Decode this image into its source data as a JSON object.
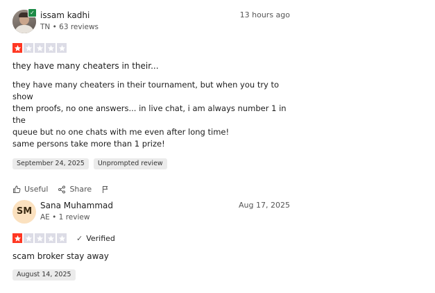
{
  "reviews": [
    {
      "reviewer_name": "issam kadhi",
      "meta": "TN • 63 reviews",
      "date": "13 hours ago",
      "rating": 1,
      "title": "they have many cheaters in their...",
      "body": "they have many cheaters in their tournament, but when you try to show\nthem proofs, no one answers... in live chat, i am always number 1 in the\nqueue but no one chats with me even after long time!\nsame persons take more than 1 prize!",
      "date_of_experience": "September 24, 2025",
      "tag": "Unprompted review",
      "actions": {
        "useful": "Useful",
        "share": "Share"
      }
    },
    {
      "reviewer_initials": "SM",
      "reviewer_name": "Sana Muhammad",
      "meta": "AE • 1 review",
      "date": "Aug 17, 2025",
      "rating": 1,
      "verified_label": "Verified",
      "title": "scam broker stay away",
      "date_of_experience": "August 14, 2025"
    }
  ],
  "colors": {
    "star_on": "#ff3722",
    "star_off": "#dcdce6",
    "verified_badge": "#1d8a47",
    "initials_bg": "#fbe1bf"
  }
}
